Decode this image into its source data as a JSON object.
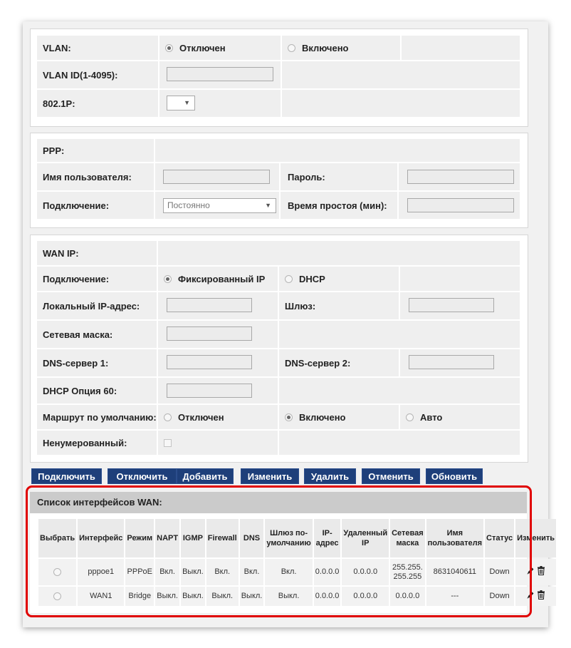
{
  "vlan": {
    "vlan_label": "VLAN:",
    "off_label": "Отключен",
    "on_label": "Включено",
    "vlan_id_label": "VLAN ID(1-4095):",
    "p8021_label": "802.1P:"
  },
  "ppp": {
    "title": "PPP:",
    "username_label": "Имя пользователя:",
    "password_label": "Пароль:",
    "connection_label": "Подключение:",
    "connection_value": "Постоянно",
    "idle_label": "Время простоя (мин):"
  },
  "wanip": {
    "title": "WAN IP:",
    "connection_label": "Подключение:",
    "fixed_label": "Фиксированный IP",
    "dhcp_label": "DHCP",
    "local_ip_label": "Локальный IP-адрес:",
    "gateway_label": "Шлюз:",
    "netmask_label": "Сетевая маска:",
    "dns1_label": "DNS-сервер 1:",
    "dns2_label": "DNS-сервер 2:",
    "dhcp60_label": "DHCP Опция 60:",
    "default_route_label": "Маршрут по умолчанию:",
    "route_off": "Отключен",
    "route_on": "Включено",
    "route_auto": "Авто",
    "unnumbered_label": "Ненумерованный:"
  },
  "buttons": {
    "connect": "Подключить",
    "disconnect": "Отключить",
    "add": "Добавить",
    "edit": "Изменить",
    "delete": "Удалить",
    "cancel": "Отменить",
    "refresh": "Обновить"
  },
  "wan_list": {
    "title": "Список интерфейсов WAN:",
    "headers": {
      "select": "Выбрать",
      "iface": "Интерфейс",
      "mode": "Режим",
      "napt": "NAPT",
      "igmp": "IGMP",
      "firewall": "Firewall",
      "dns": "DNS",
      "default_gw": "Шлюз по-умолчанию",
      "ip": "IP-адрес",
      "remote_ip": "Удаленный IP",
      "netmask": "Сетевая маска",
      "username": "Имя пользователя",
      "status": "Статус",
      "edit": "Изменить"
    },
    "rows": [
      {
        "iface": "pppoe1",
        "mode": "PPPoE",
        "napt": "Вкл.",
        "igmp": "Выкл.",
        "firewall": "Вкл.",
        "dns": "Вкл.",
        "default_gw": "Вкл.",
        "ip": "0.0.0.0",
        "remote_ip": "0.0.0.0",
        "netmask": "255.255.255.255",
        "username": "8631040611",
        "status": "Down"
      },
      {
        "iface": "WAN1",
        "mode": "Bridge",
        "napt": "Выкл.",
        "igmp": "Выкл.",
        "firewall": "Выкл.",
        "dns": "Выкл.",
        "default_gw": "Выкл.",
        "ip": "0.0.0.0",
        "remote_ip": "0.0.0.0",
        "netmask": "0.0.0.0",
        "username": "---",
        "status": "Down"
      }
    ]
  },
  "icons": {
    "edit": "pencil-icon",
    "delete": "trash-icon"
  },
  "colors": {
    "button": "#1e3f7a",
    "highlight": "#e00000"
  }
}
